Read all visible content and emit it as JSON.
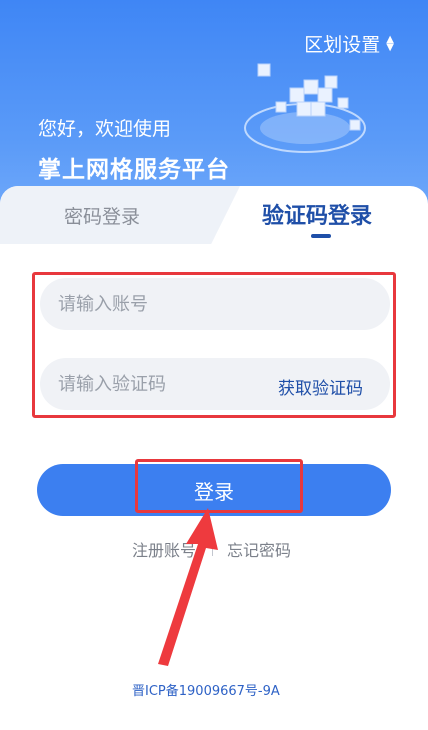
{
  "header": {
    "region_label": "区划设置",
    "welcome": "您好，欢迎使用",
    "platform_name": "掌上网格服务平台"
  },
  "tabs": {
    "password_login": "密码登录",
    "sms_login": "验证码登录",
    "active": "sms_login"
  },
  "form": {
    "account_placeholder": "请输入账号",
    "account_value": "",
    "code_placeholder": "请输入验证码",
    "code_value": "",
    "get_code_label": "获取验证码"
  },
  "actions": {
    "login_label": "登录",
    "register_label": "注册账号",
    "forgot_label": "忘记密码"
  },
  "footer": {
    "icp": "晋ICP备19009667号-9A"
  },
  "colors": {
    "primary": "#3c7ff0",
    "accent_text": "#1f4fa8",
    "annotation": "#e8383d"
  }
}
